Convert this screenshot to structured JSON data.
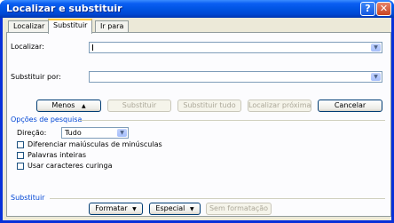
{
  "window": {
    "title": "Localizar e substituir"
  },
  "tabs": [
    {
      "label": "Localizar",
      "active": false
    },
    {
      "label": "Substituir",
      "active": true
    },
    {
      "label": "Ir para",
      "active": false
    }
  ],
  "find": {
    "label": "Localizar:",
    "value": ""
  },
  "replace": {
    "label": "Substituir por:",
    "value": ""
  },
  "buttons": {
    "less": "Menos",
    "less_arrow": "▲",
    "replace": "Substituir",
    "replace_all": "Substituir tudo",
    "find_next": "Localizar próxima",
    "cancel": "Cancelar"
  },
  "search_options": {
    "title": "Opções de pesquisa",
    "direction_label": "Direção:",
    "direction_value": "Tudo",
    "checkboxes": [
      {
        "label": "Diferenciar maiúsculas de minúsculas",
        "checked": false
      },
      {
        "label": "Palavras inteiras",
        "checked": false
      },
      {
        "label": "Usar caracteres curinga",
        "checked": false
      }
    ]
  },
  "replace_section": {
    "title": "Substituir",
    "format": "Formatar",
    "special": "Especial",
    "no_format": "Sem formatação"
  },
  "colors": {
    "title_bar": "#0054e3",
    "section_text": "#0046d5",
    "dialog_bg": "#ece9d8"
  }
}
